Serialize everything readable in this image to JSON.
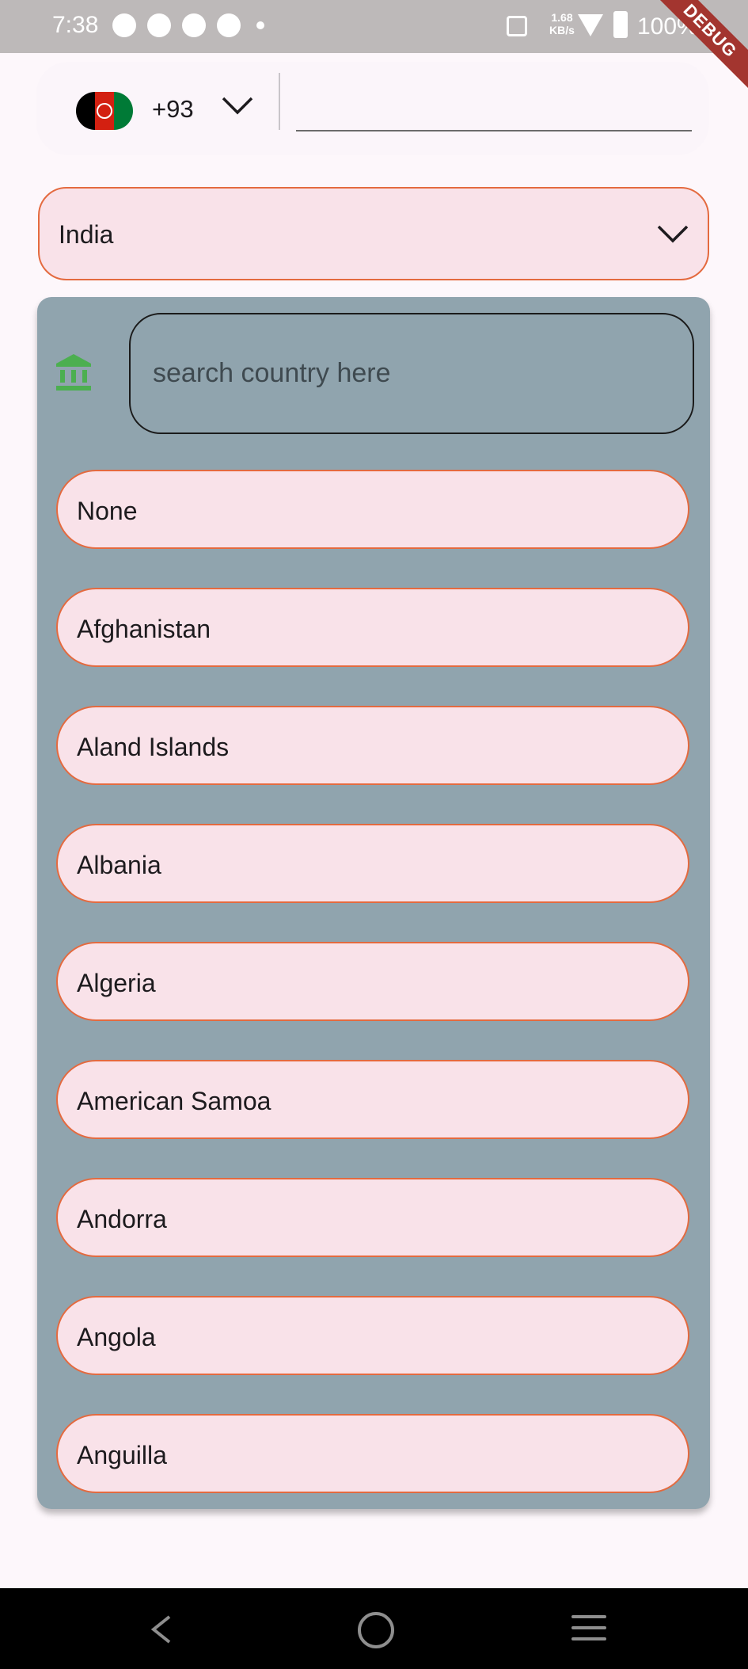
{
  "status_bar": {
    "time": "7:38",
    "net_speed": "1.68 KB/s",
    "battery": "100%",
    "debug_label": "DEBUG"
  },
  "phone": {
    "flag_icon": "afghanistan-flag",
    "dial_code": "+93",
    "number_value": "",
    "chevron_icon": "chevron-down-icon"
  },
  "country_select": {
    "selected": "India",
    "chevron_icon": "chevron-down-icon"
  },
  "dropdown": {
    "leading_icon": "bank-icon",
    "leading_icon_color": "#4caf50",
    "search_placeholder": "search country here",
    "options": [
      "None",
      "Afghanistan",
      "Aland Islands",
      "Albania",
      "Algeria",
      "American Samoa",
      "Andorra",
      "Angola",
      "Anguilla"
    ]
  },
  "colors": {
    "option_fill": "#f9e2e9",
    "option_border": "#e46a3f",
    "panel_bg": "#90a4ae"
  },
  "nav_bar": {
    "back_icon": "back-icon",
    "home_icon": "home-icon",
    "recents_icon": "menu-icon"
  }
}
